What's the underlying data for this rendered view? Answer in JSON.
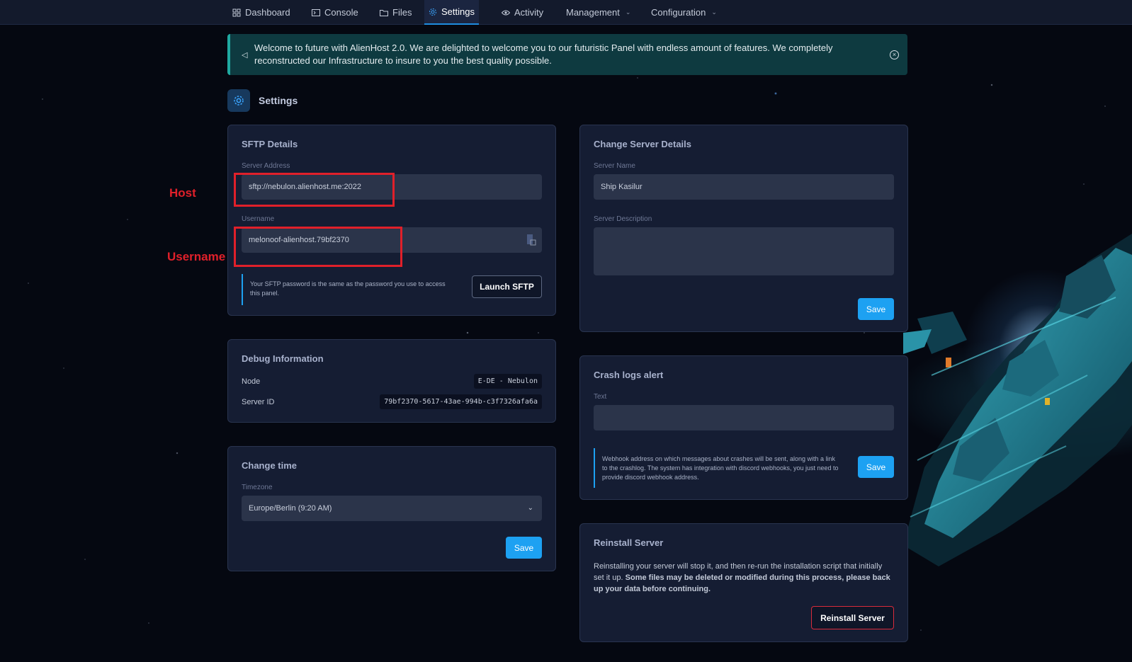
{
  "nav": {
    "items": [
      {
        "label": "Dashboard",
        "icon": "grid-icon"
      },
      {
        "label": "Console",
        "icon": "terminal-icon"
      },
      {
        "label": "Files",
        "icon": "folder-icon"
      },
      {
        "label": "Settings",
        "icon": "gear-icon",
        "active": true
      },
      {
        "label": "Activity",
        "icon": "eye-icon"
      },
      {
        "label": "Management",
        "dropdown": true
      },
      {
        "label": "Configuration",
        "dropdown": true
      }
    ]
  },
  "announcement": {
    "text": "Welcome to future with AlienHost 2.0. We are delighted to welcome you to our futuristic Panel with endless amount of features. We completely reconstructed our Infrastructure to insure to you the best quality possible."
  },
  "page": {
    "title": "Settings"
  },
  "sftp": {
    "title": "SFTP Details",
    "server_address_label": "Server Address",
    "server_address": "sftp://nebulon.alienhost.me:2022",
    "username_label": "Username",
    "username": "melonoof-alienhost.79bf2370",
    "note": "Your SFTP password is the same as the password you use to access this panel.",
    "launch_label": "Launch SFTP"
  },
  "debug": {
    "title": "Debug Information",
    "node_label": "Node",
    "node_value": "E-DE - Nebulon",
    "server_id_label": "Server ID",
    "server_id_value": "79bf2370-5617-43ae-994b-c3f7326afa6a"
  },
  "time": {
    "title": "Change time",
    "timezone_label": "Timezone",
    "timezone_value": "Europe/Berlin (9:20 AM)",
    "save_label": "Save"
  },
  "server_details": {
    "title": "Change Server Details",
    "name_label": "Server Name",
    "name_value": "Ship Kasilur",
    "description_label": "Server Description",
    "description_value": "",
    "save_label": "Save"
  },
  "crash": {
    "title": "Crash logs alert",
    "text_label": "Text",
    "text_value": "",
    "note": "Webhook address on which messages about crashes will be sent, along with a link to the crashlog. The system has integration with discord webhooks, you just need to provide discord webhook address.",
    "save_label": "Save"
  },
  "reinstall": {
    "title": "Reinstall Server",
    "text_plain": "Reinstalling your server will stop it, and then re-run the installation script that initially set it up. ",
    "text_bold": "Some files may be deleted or modified during this process, please back up your data before continuing.",
    "button_label": "Reinstall Server"
  },
  "annotations": {
    "host_label": "Host",
    "username_label": "Username"
  },
  "colors": {
    "accent": "#1da1f2",
    "annotation_red": "#e0202a",
    "announcement_bg": "#0e3a40",
    "card_bg": "#151d33"
  }
}
